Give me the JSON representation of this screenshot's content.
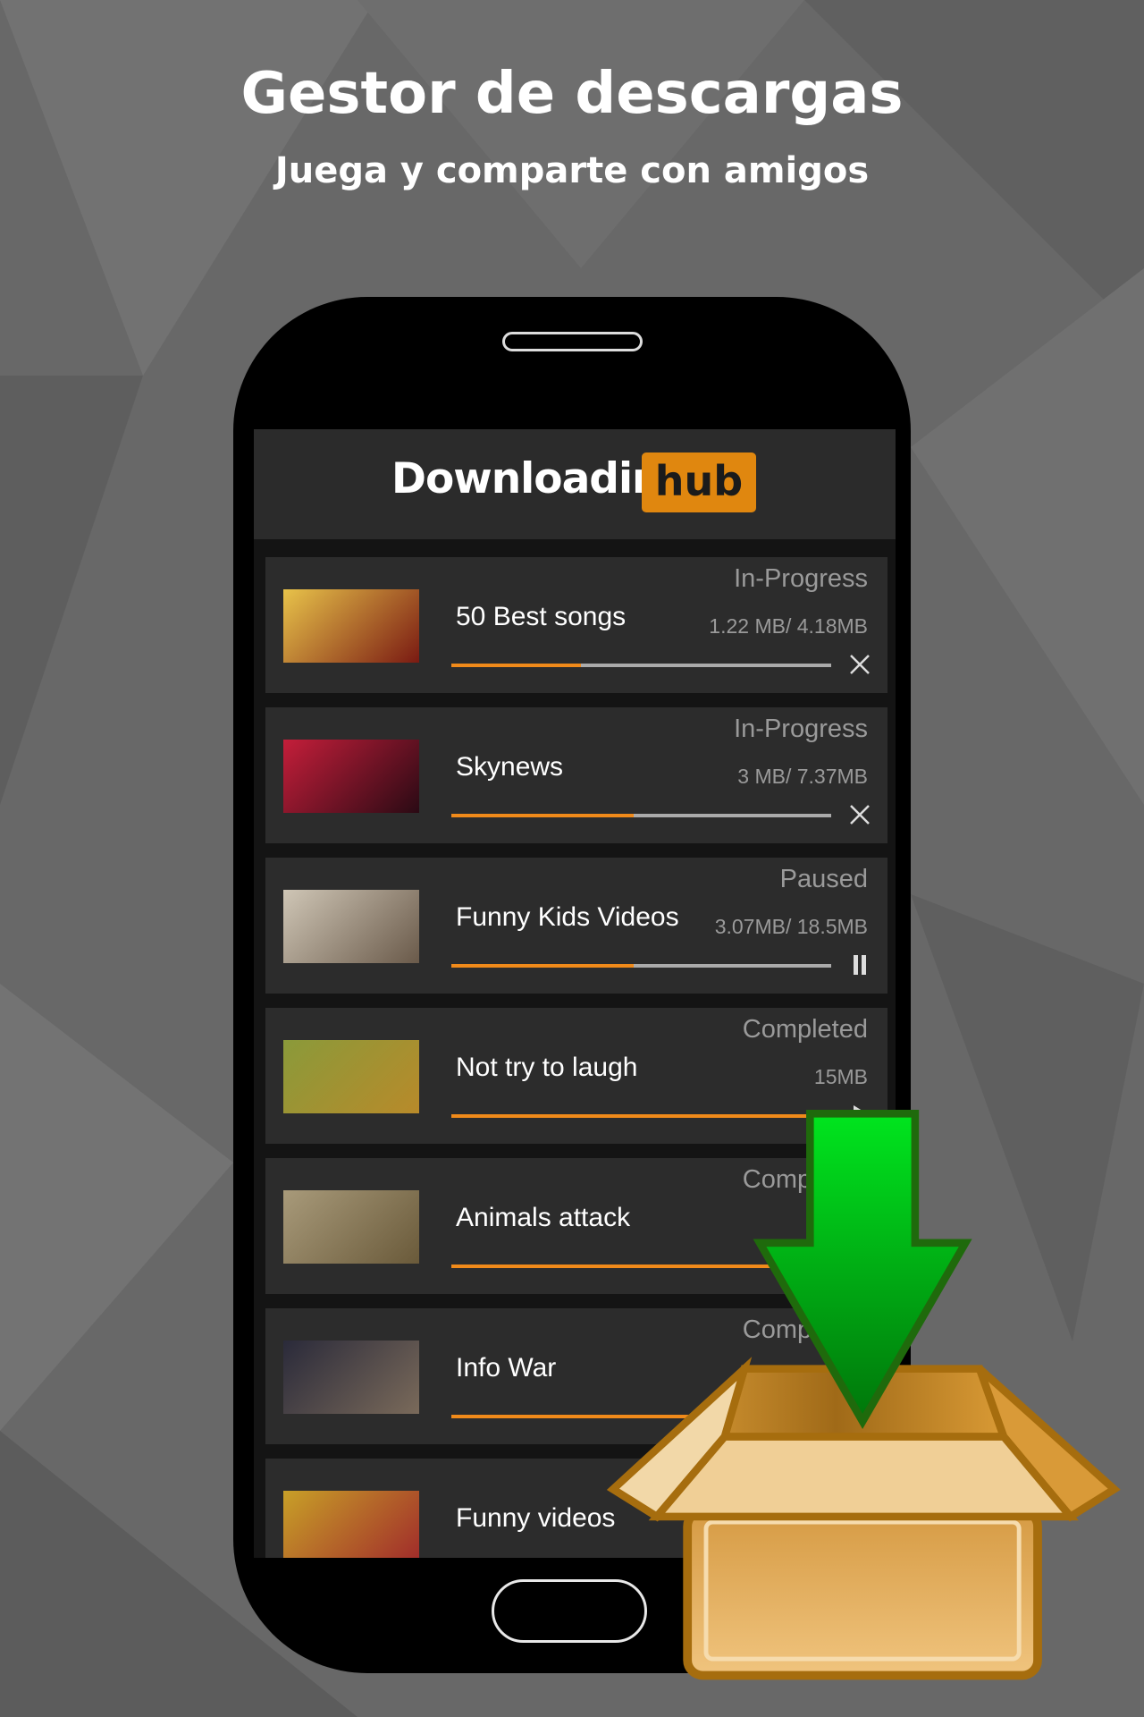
{
  "promo": {
    "title": "Gestor de descargas",
    "subtitle": "Juega y comparte con amigos"
  },
  "app": {
    "brand_text": "Downloading",
    "brand_badge": "hub",
    "accent_color": "#f08a1a",
    "badge_color": "#e0870f"
  },
  "downloads": [
    {
      "title": "50 Best songs",
      "status": "In-Progress",
      "size": "1.22 MB/ 4.18MB",
      "progress": 0.34,
      "action_icon": "close-icon",
      "thumb_colors": [
        "#e8c34a",
        "#7a1a12"
      ]
    },
    {
      "title": "Skynews",
      "status": "In-Progress",
      "size": "3 MB/ 7.37MB",
      "progress": 0.48,
      "action_icon": "close-icon",
      "thumb_colors": [
        "#c41e3a",
        "#2a0a14"
      ]
    },
    {
      "title": "Funny Kids Videos",
      "status": "Paused",
      "size": "3.07MB/ 18.5MB",
      "progress": 0.48,
      "action_icon": "pause-icon",
      "thumb_colors": [
        "#cfc6b6",
        "#6a5a4a"
      ]
    },
    {
      "title": "Not try to laugh",
      "status": "Completed",
      "size": "15MB",
      "progress": 1.0,
      "action_icon": "play-icon",
      "thumb_colors": [
        "#8a9a3a",
        "#b88a2a"
      ]
    },
    {
      "title": "Animals attack",
      "status": "Completed",
      "size": "",
      "progress": 1.0,
      "action_icon": "",
      "thumb_colors": [
        "#a89a7a",
        "#6a5a3a"
      ]
    },
    {
      "title": "Info War",
      "status": "Completed",
      "size": "",
      "progress": 1.0,
      "action_icon": "",
      "thumb_colors": [
        "#2a2a3a",
        "#7a6a5a"
      ]
    },
    {
      "title": "Funny videos",
      "status": "",
      "size": "",
      "progress": 0,
      "action_icon": "",
      "thumb_colors": [
        "#c8a028",
        "#a02a2a"
      ]
    }
  ]
}
